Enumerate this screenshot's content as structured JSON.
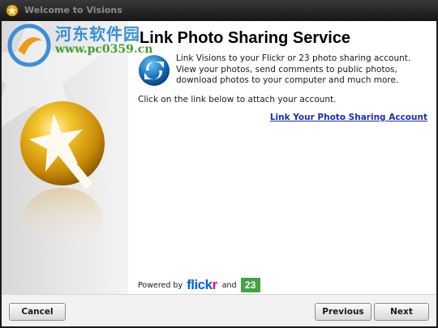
{
  "window": {
    "title": "Welcome to Visions",
    "title_icon": "sparkle-star-icon"
  },
  "watermark": {
    "brand_cn": "河东软件园",
    "url": "www.pc0359.cn",
    "icon": "watermark-logo-icon"
  },
  "sidebar": {
    "logo_icon": "golden-star-wand-icon",
    "background_icon": "faint-star-icon"
  },
  "content": {
    "heading": "Link Photo Sharing Service",
    "service_icon": "blue-sync-arrows-icon",
    "description": "Link Visions to your Flickr or 23 photo sharing account. View your photos, send comments to public photos, download photos to your computer and much more.",
    "instruction": "Click on the link below to attach your account.",
    "link_label": "Link Your Photo Sharing Account"
  },
  "powered_by": {
    "label": "Powered by",
    "flickr_part1": "flick",
    "flickr_part2": "r",
    "and": "and",
    "logo_23": "23"
  },
  "colors": {
    "link": "#1a2fb0",
    "flickr_blue": "#0063dc",
    "flickr_pink": "#ff0084",
    "logo_23_green": "#46a345",
    "gold": "#e8a814"
  },
  "buttons": {
    "cancel": "Cancel",
    "previous": "Previous",
    "next": "Next"
  }
}
